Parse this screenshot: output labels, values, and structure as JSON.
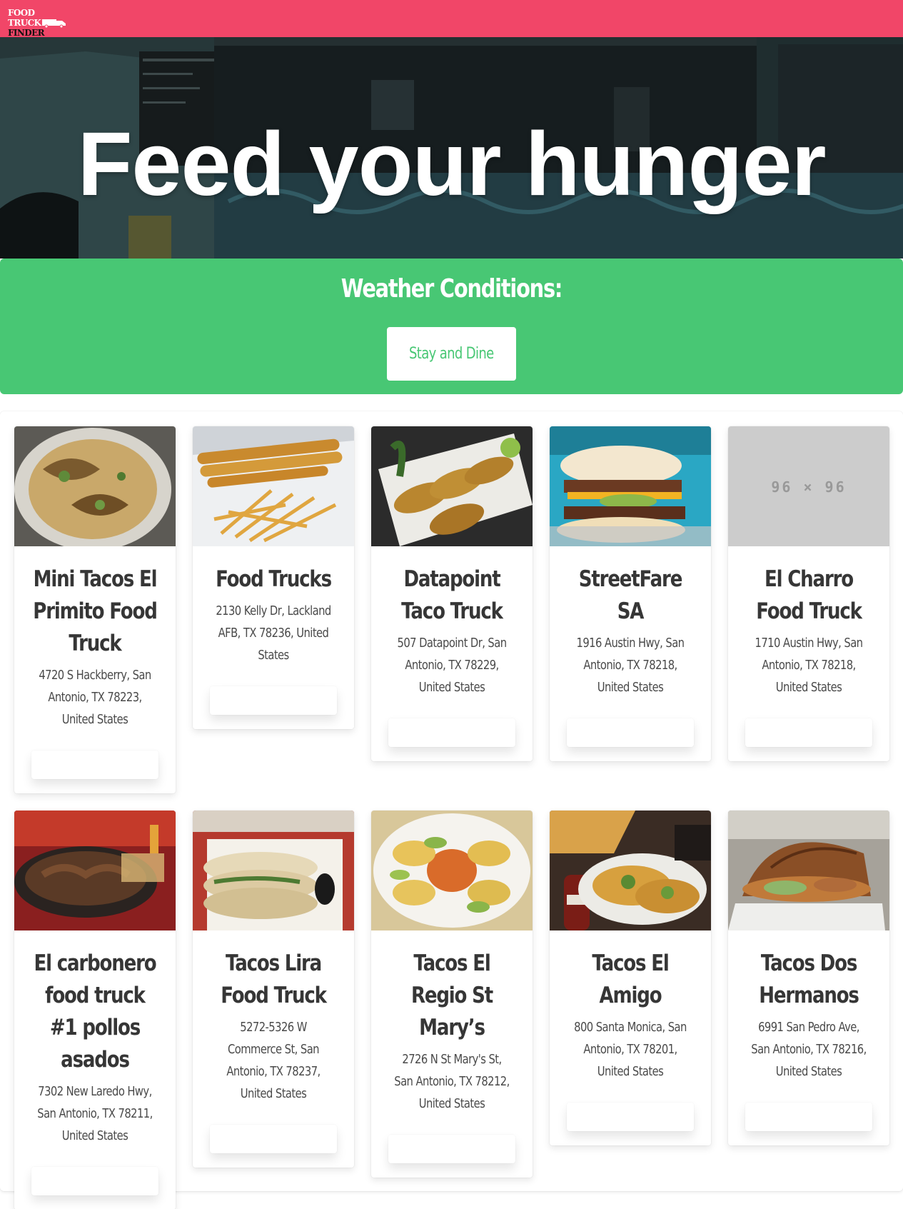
{
  "navbar": {
    "logo_line1": "FOOD TRUCK",
    "logo_line2": "FINDER",
    "brand_color": "#f14668"
  },
  "hero": {
    "title": "Feed your hunger"
  },
  "weather": {
    "title": "Weather Conditions:",
    "button_label": "Stay and Dine",
    "color": "#48c774"
  },
  "trucks": [
    {
      "name": "Mini Tacos El Primito Food Truck",
      "address": "4720 S Hackberry, San Antonio, TX 78223, United States"
    },
    {
      "name": "Food Trucks",
      "address": "2130 Kelly Dr, Lackland AFB, TX 78236, United States"
    },
    {
      "name": "Datapoint Taco Truck",
      "address": "507 Datapoint Dr, San Antonio, TX 78229, United States"
    },
    {
      "name": "StreetFare SA",
      "address": "1916 Austin Hwy, San Antonio, TX 78218, United States"
    },
    {
      "name": "El Charro Food Truck",
      "address": "1710 Austin Hwy, San Antonio, TX 78218, United States",
      "image_placeholder": "96 × 96"
    },
    {
      "name": "El carbonero food truck #1 pollos asados",
      "address": "7302 New Laredo Hwy, San Antonio, TX 78211, United States"
    },
    {
      "name": "Tacos Lira Food Truck",
      "address": "5272-5326 W Commerce St, San Antonio, TX 78237, United States"
    },
    {
      "name": "Tacos El Regio St Mary’s",
      "address": "2726 N St Mary's St, San Antonio, TX 78212, United States"
    },
    {
      "name": "Tacos El Amigo",
      "address": "800 Santa Monica, San Antonio, TX 78201, United States"
    },
    {
      "name": "Tacos Dos Hermanos",
      "address": "6991 San Pedro Ave, San Antonio, TX 78216, United States"
    }
  ]
}
